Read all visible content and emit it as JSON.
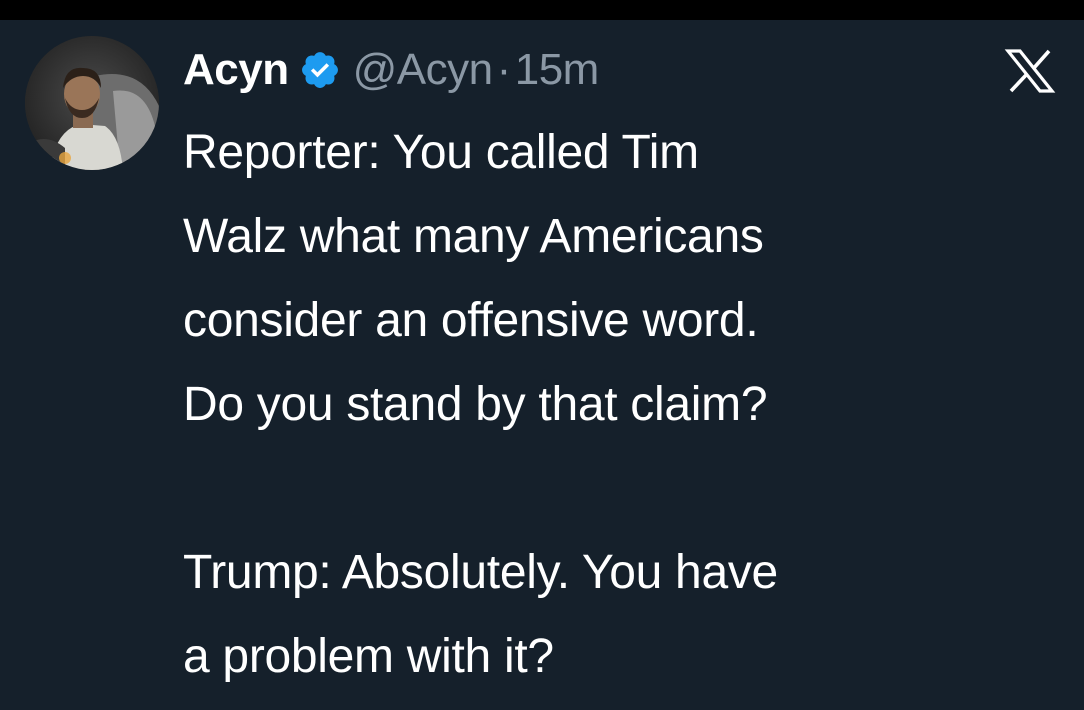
{
  "tweet": {
    "display_name": "Acyn",
    "handle": "@Acyn",
    "separator": "·",
    "timestamp": "15m",
    "verified": true,
    "platform_logo": "x-logo",
    "avatar_icon": "user-photo",
    "paragraphs": [
      "Reporter: You called Tim\nWalz what many Americans\nconsider an offensive word.\nDo you stand by that claim?",
      "Trump: Absolutely. You have\na problem with it?"
    ]
  },
  "colors": {
    "background": "#15202b",
    "text": "#ffffff",
    "secondary_text": "#8b98a5",
    "verified_badge": "#1d9bf0"
  }
}
